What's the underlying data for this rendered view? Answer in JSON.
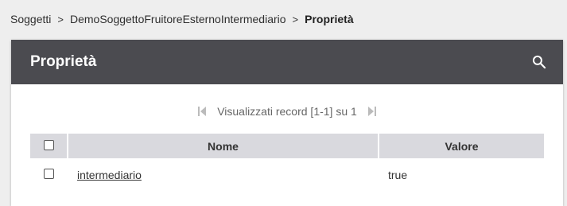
{
  "breadcrumb": {
    "items": [
      "Soggetti",
      "DemoSoggettoFruitoreEsternoIntermediario"
    ],
    "current": "Proprietà",
    "separator": ">"
  },
  "panel": {
    "title": "Proprietà",
    "search_icon": "search-icon",
    "header_color": "#4b4b50"
  },
  "pager": {
    "text": "Visualizzati record [1-1] su 1",
    "first_icon": "first-page-icon",
    "last_icon": "last-page-icon"
  },
  "table": {
    "columns": [
      "",
      "Nome",
      "Valore"
    ],
    "rows": [
      {
        "checked": false,
        "name": "intermediario",
        "value": "true"
      }
    ]
  }
}
